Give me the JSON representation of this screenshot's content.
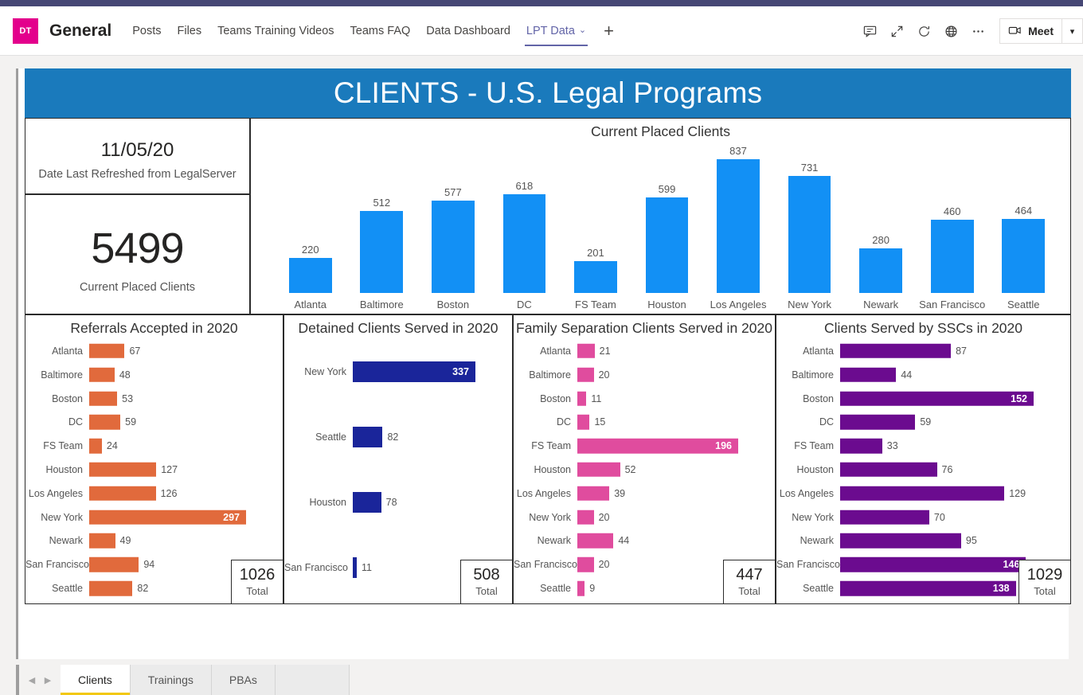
{
  "teams": {
    "avatar_initials": "DT",
    "channel_title": "General",
    "tabs": [
      {
        "label": "Posts",
        "active": false,
        "caret": false
      },
      {
        "label": "Files",
        "active": false,
        "caret": false
      },
      {
        "label": "Teams Training Videos",
        "active": false,
        "caret": false
      },
      {
        "label": "Teams FAQ",
        "active": false,
        "caret": false
      },
      {
        "label": "Data Dashboard",
        "active": false,
        "caret": false
      },
      {
        "label": "LPT Data",
        "active": true,
        "caret": true
      }
    ],
    "add_tab_label": "+",
    "toolbar_icons": [
      "chat-icon",
      "expand-icon",
      "refresh-icon",
      "globe-icon",
      "more-options-icon"
    ],
    "meet_label": "Meet",
    "accent_color": "#6264a7",
    "avatar_color": "#e3008c"
  },
  "report": {
    "banner_title": "CLIENTS - U.S. Legal Programs",
    "banner_color": "#1a7abc",
    "kpi_date": {
      "value": "11/05/20",
      "label": "Date Last Refreshed from LegalServer"
    },
    "kpi_clients": {
      "value": "5499",
      "label": "Current Placed Clients"
    },
    "page_tabs": [
      {
        "label": "Clients",
        "active": true
      },
      {
        "label": "Trainings",
        "active": false
      },
      {
        "label": "PBAs",
        "active": false
      }
    ],
    "page_tab_accent": "#f2c811"
  },
  "chart_data": [
    {
      "id": "current_placed_clients",
      "type": "bar",
      "orientation": "vertical",
      "title": "Current Placed Clients",
      "xlabel": "",
      "ylabel": "",
      "ylim": [
        0,
        900
      ],
      "grid": false,
      "legend": "none",
      "color": "#1290f5",
      "data_labels": true,
      "categories": [
        "Atlanta",
        "Baltimore",
        "Boston",
        "DC",
        "FS Team",
        "Houston",
        "Los Angeles",
        "New York",
        "Newark",
        "San Francisco",
        "Seattle"
      ],
      "values": [
        220,
        512,
        577,
        618,
        201,
        599,
        837,
        731,
        280,
        460,
        464
      ]
    },
    {
      "id": "referrals_accepted_2020",
      "type": "bar",
      "orientation": "horizontal",
      "title": "Referrals Accepted in 2020",
      "xlabel": "",
      "ylabel": "",
      "xlim": [
        0,
        297
      ],
      "grid": false,
      "legend": "none",
      "color": "#e16a3c",
      "data_labels": true,
      "total_label": "Total",
      "total": 1026,
      "categories": [
        "Atlanta",
        "Baltimore",
        "Boston",
        "DC",
        "FS Team",
        "Houston",
        "Los Angeles",
        "New York",
        "Newark",
        "San Francisco",
        "Seattle"
      ],
      "values": [
        67,
        48,
        53,
        59,
        24,
        127,
        126,
        297,
        49,
        94,
        82
      ]
    },
    {
      "id": "detained_clients_2020",
      "type": "bar",
      "orientation": "horizontal",
      "title": "Detained Clients Served in 2020",
      "xlabel": "",
      "ylabel": "",
      "xlim": [
        0,
        337
      ],
      "grid": false,
      "legend": "none",
      "color": "#1a259a",
      "data_labels": true,
      "total_label": "Total",
      "total": 508,
      "categories": [
        "New York",
        "Seattle",
        "Houston",
        "San Francisco"
      ],
      "values": [
        337,
        82,
        78,
        11
      ]
    },
    {
      "id": "family_separation_clients_2020",
      "type": "bar",
      "orientation": "horizontal",
      "title": "Family Separation Clients Served in 2020",
      "xlabel": "",
      "ylabel": "",
      "xlim": [
        0,
        196
      ],
      "grid": false,
      "legend": "none",
      "color": "#e04c9e",
      "data_labels": true,
      "total_label": "Total",
      "total": 447,
      "categories": [
        "Atlanta",
        "Baltimore",
        "Boston",
        "DC",
        "FS Team",
        "Houston",
        "Los Angeles",
        "New York",
        "Newark",
        "San Francisco",
        "Seattle"
      ],
      "values": [
        21,
        20,
        11,
        15,
        196,
        52,
        39,
        20,
        44,
        20,
        9
      ]
    },
    {
      "id": "clients_served_by_sscs_2020",
      "type": "bar",
      "orientation": "horizontal",
      "title": "Clients Served by SSCs in 2020",
      "xlabel": "",
      "ylabel": "",
      "xlim": [
        0,
        152
      ],
      "grid": false,
      "legend": "none",
      "color": "#6b0b8f",
      "data_labels": true,
      "total_label": "Total",
      "total": 1029,
      "categories": [
        "Atlanta",
        "Baltimore",
        "Boston",
        "DC",
        "FS Team",
        "Houston",
        "Los Angeles",
        "New York",
        "Newark",
        "San Francisco",
        "Seattle"
      ],
      "values": [
        87,
        44,
        152,
        59,
        33,
        76,
        129,
        70,
        95,
        146,
        138
      ]
    }
  ]
}
